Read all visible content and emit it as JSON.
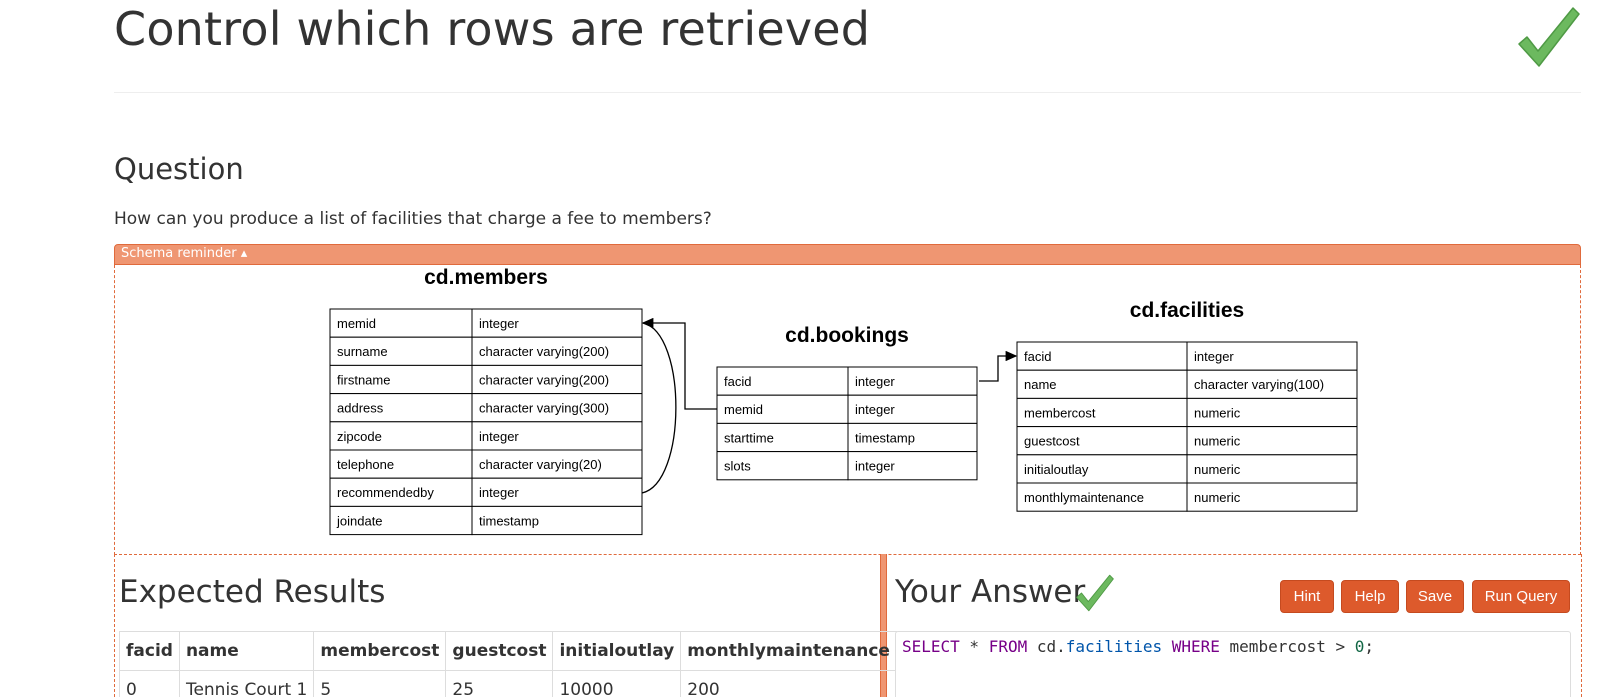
{
  "page": {
    "title": "Control which rows are retrieved"
  },
  "question": {
    "heading": "Question",
    "text": "How can you produce a list of facilities that charge a fee to members?"
  },
  "schema": {
    "toggle_label": "Schema reminder ▴",
    "tables": [
      {
        "name": "cd.members",
        "columns": [
          {
            "name": "memid",
            "type": "integer"
          },
          {
            "name": "surname",
            "type": "character varying(200)"
          },
          {
            "name": "firstname",
            "type": "character varying(200)"
          },
          {
            "name": "address",
            "type": "character varying(300)"
          },
          {
            "name": "zipcode",
            "type": "integer"
          },
          {
            "name": "telephone",
            "type": "character varying(20)"
          },
          {
            "name": "recommendedby",
            "type": "integer"
          },
          {
            "name": "joindate",
            "type": "timestamp"
          }
        ]
      },
      {
        "name": "cd.bookings",
        "columns": [
          {
            "name": "facid",
            "type": "integer"
          },
          {
            "name": "memid",
            "type": "integer"
          },
          {
            "name": "starttime",
            "type": "timestamp"
          },
          {
            "name": "slots",
            "type": "integer"
          }
        ]
      },
      {
        "name": "cd.facilities",
        "columns": [
          {
            "name": "facid",
            "type": "integer"
          },
          {
            "name": "name",
            "type": "character varying(100)"
          },
          {
            "name": "membercost",
            "type": "numeric"
          },
          {
            "name": "guestcost",
            "type": "numeric"
          },
          {
            "name": "initialoutlay",
            "type": "numeric"
          },
          {
            "name": "monthlymaintenance",
            "type": "numeric"
          }
        ]
      }
    ]
  },
  "expected": {
    "heading": "Expected Results",
    "columns": [
      "facid",
      "name",
      "membercost",
      "guestcost",
      "initialoutlay",
      "monthlymaintenance"
    ],
    "rows": [
      [
        "0",
        "Tennis Court 1",
        "5",
        "25",
        "10000",
        "200"
      ]
    ]
  },
  "answer": {
    "heading": "Your Answer",
    "buttons": {
      "hint": "Hint",
      "help": "Help",
      "save": "Save",
      "run": "Run Query"
    },
    "query": {
      "kw_select": "SELECT",
      "star": " * ",
      "kw_from": "FROM",
      "schema": " cd.",
      "table": "facilities",
      "kw_where": "WHERE",
      "column": " membercost > ",
      "value": "0",
      "end": ";"
    }
  },
  "colors": {
    "accent": "#dd5a2c",
    "schema_bar": "#ef9672",
    "check": "#6cb95f"
  },
  "icons": {
    "title_status": "check-icon",
    "answer_status": "check-icon"
  }
}
